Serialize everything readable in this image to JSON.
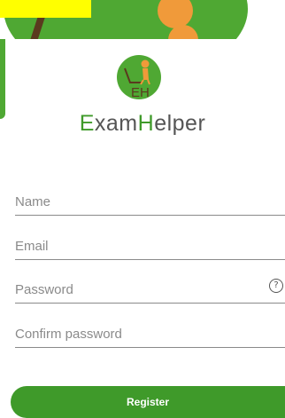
{
  "app": {
    "title_prefix_letter": "E",
    "title_mid": "xam",
    "title_h_letter": "H",
    "title_suffix": "elper",
    "logo_text": "EH"
  },
  "form": {
    "name_placeholder": "Name",
    "email_placeholder": "Email",
    "password_placeholder": "Password",
    "confirm_placeholder": "Confirm password",
    "help_glyph": "?",
    "register_label": "Register"
  },
  "colors": {
    "brand_green": "#3f9a2a",
    "accent_orange": "#f09a3a",
    "banner_yellow": "#ffff00"
  },
  "icons": {
    "help": "question-circle-icon"
  }
}
